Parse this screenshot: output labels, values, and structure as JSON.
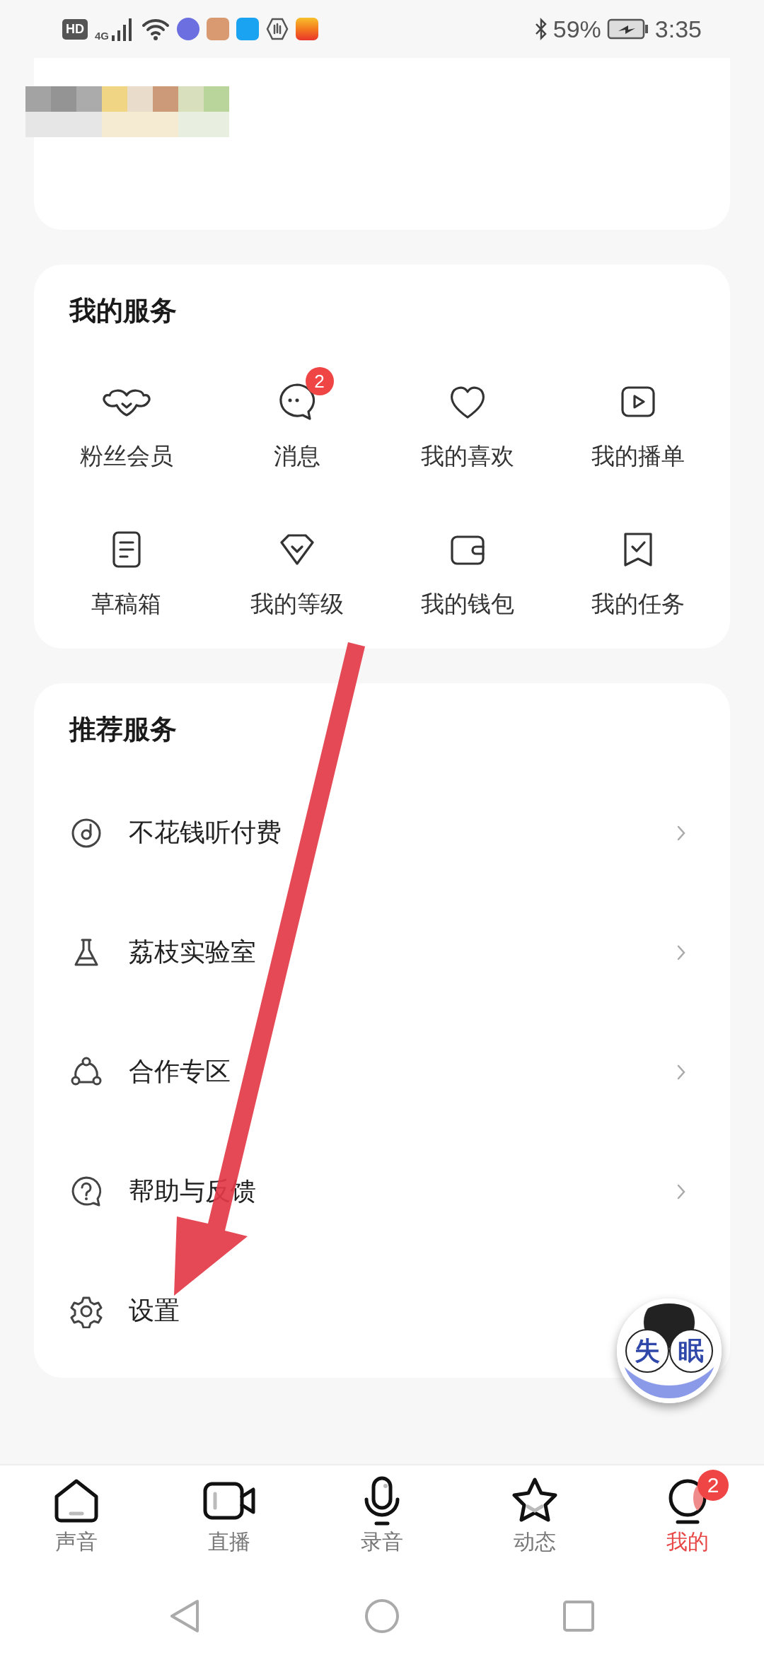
{
  "status_bar": {
    "hd": "HD",
    "network": "4G",
    "battery": "59%",
    "time": "3:35"
  },
  "my_services": {
    "title": "我的服务",
    "items": [
      {
        "label": "粉丝会员"
      },
      {
        "label": "消息",
        "badge": "2"
      },
      {
        "label": "我的喜欢"
      },
      {
        "label": "我的播单"
      },
      {
        "label": "草稿箱"
      },
      {
        "label": "我的等级"
      },
      {
        "label": "我的钱包"
      },
      {
        "label": "我的任务"
      }
    ]
  },
  "recommended": {
    "title": "推荐服务",
    "items": [
      {
        "label": "不花钱听付费",
        "chevron": true
      },
      {
        "label": "荔枝实验室",
        "chevron": true
      },
      {
        "label": "合作专区",
        "chevron": true
      },
      {
        "label": "帮助与反馈",
        "chevron": true
      },
      {
        "label": "设置",
        "chevron": false
      }
    ]
  },
  "floating_badge": {
    "text_1": "失",
    "text_2": "眠"
  },
  "bottom_nav": [
    {
      "label": "声音",
      "selected": false
    },
    {
      "label": "直播",
      "selected": false
    },
    {
      "label": "录音",
      "selected": false
    },
    {
      "label": "动态",
      "selected": false
    },
    {
      "label": "我的",
      "selected": true,
      "badge": "2"
    }
  ]
}
